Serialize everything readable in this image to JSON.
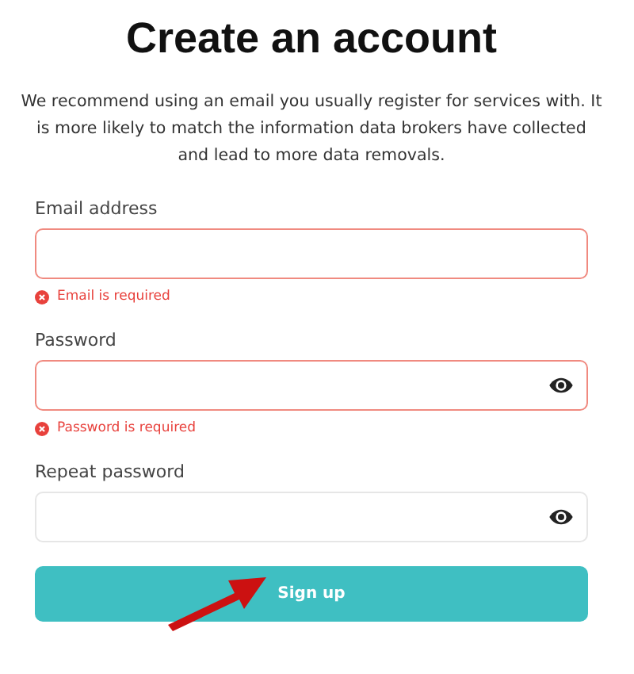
{
  "title": "Create an account",
  "intro": "We recommend using an email you usually register for services with. It is more likely to match the information data brokers have collected and lead to more data removals.",
  "fields": [
    {
      "label": "Email address",
      "kind": "email",
      "invalid": true,
      "error": "Email is required"
    },
    {
      "label": "Password",
      "kind": "password",
      "invalid": true,
      "error": "Password is required"
    },
    {
      "label": "Repeat password",
      "kind": "password",
      "invalid": false
    }
  ],
  "submit": {
    "label": "Sign up",
    "annotated": true
  }
}
